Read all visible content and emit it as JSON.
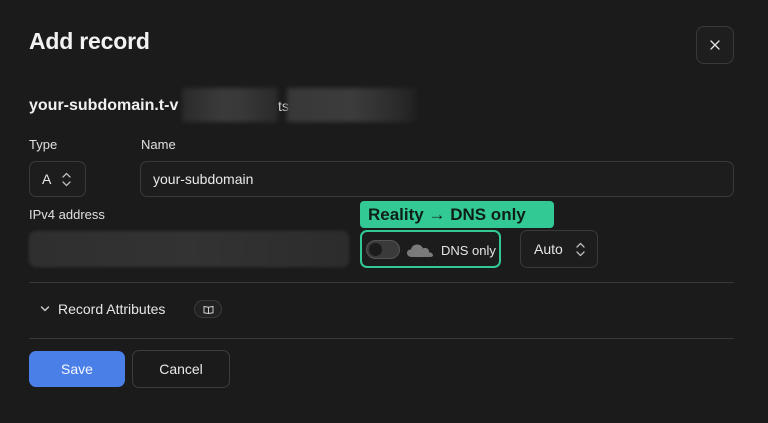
{
  "dialog": {
    "title": "Add record",
    "close_label": "close"
  },
  "record": {
    "fqdn_prefix": "your-subdomain.t-v",
    "fqdn_fragment": "ts"
  },
  "fields": {
    "type_label": "Type",
    "type_value": "A",
    "name_label": "Name",
    "name_value": "your-subdomain",
    "ipv4_label": "IPv4 address"
  },
  "proxy": {
    "annotation": "Reality → DNS only",
    "toggle_on": false,
    "status_label": "DNS only"
  },
  "ttl": {
    "value": "Auto"
  },
  "attributes": {
    "label": "Record Attributes"
  },
  "actions": {
    "save_label": "Save",
    "cancel_label": "Cancel"
  },
  "colors": {
    "accent": "#4b7fe8",
    "annotation": "#32c995",
    "background": "#1b1b1b"
  }
}
